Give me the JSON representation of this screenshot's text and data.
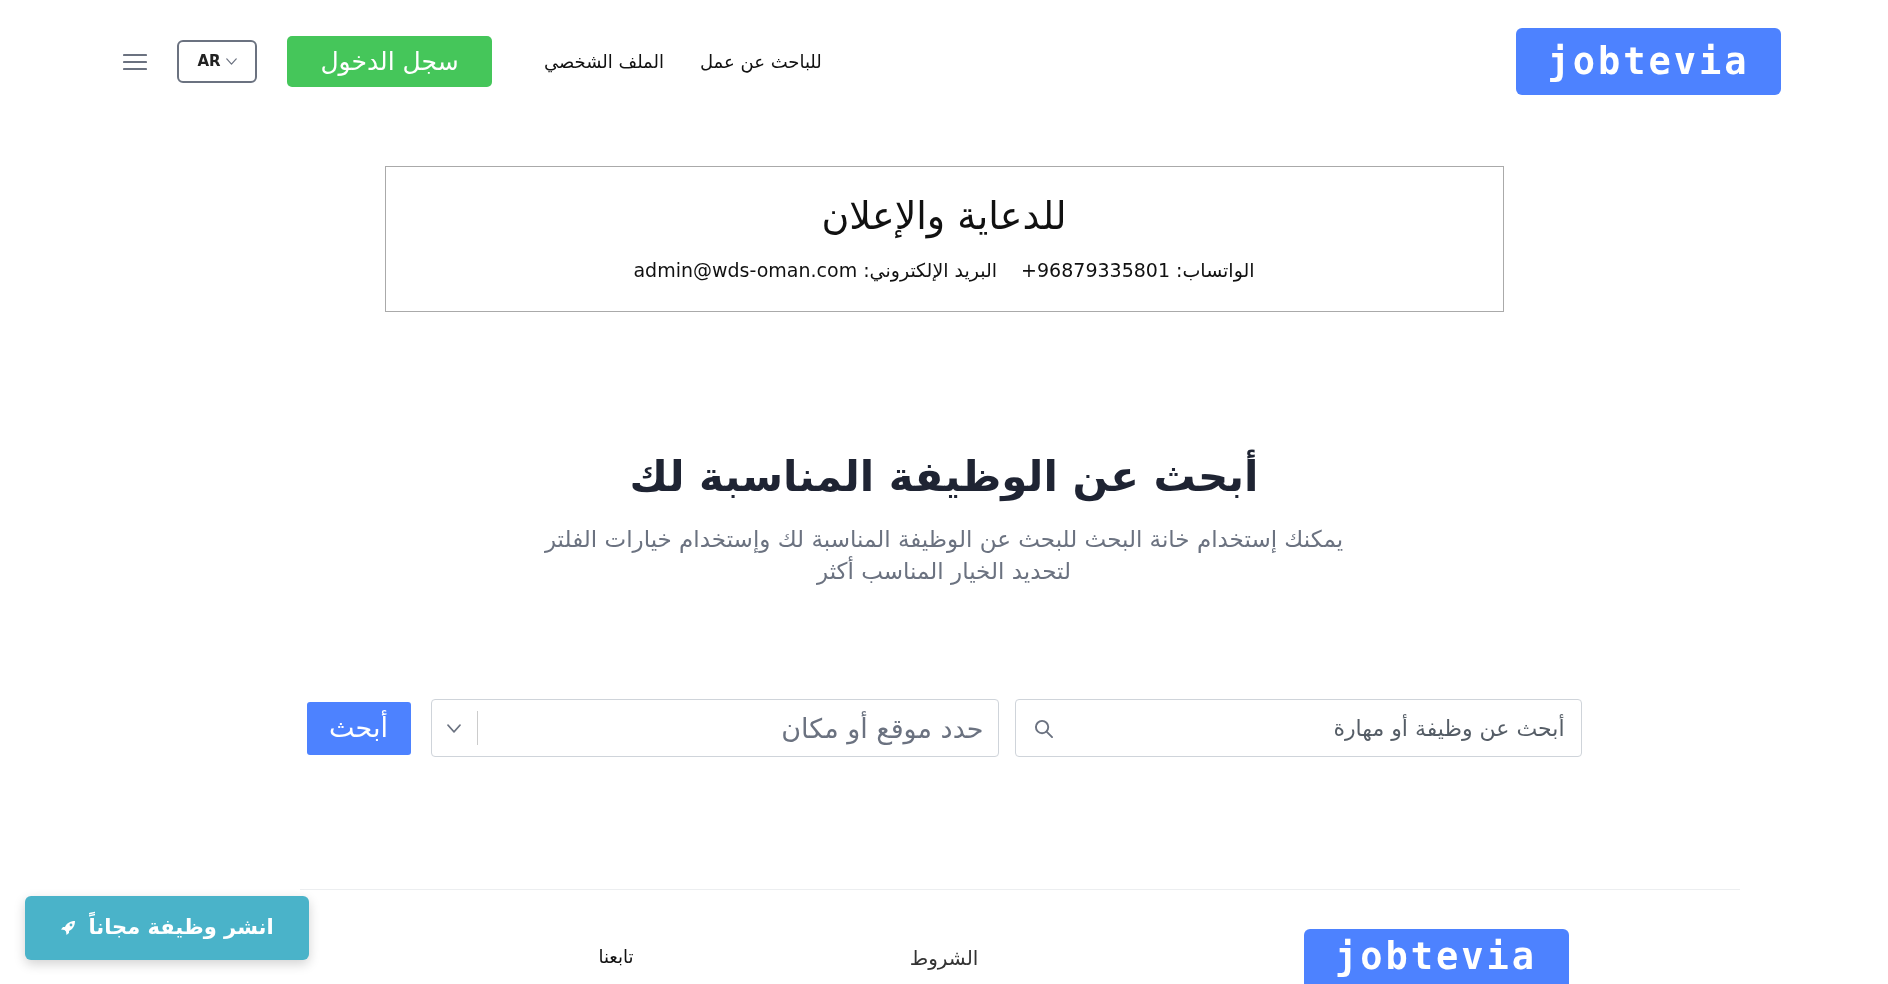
{
  "header": {
    "logo": "jobtevia",
    "nav_links": [
      "للباحث عن عمل",
      "الملف الشخصي"
    ],
    "login_button": "سجل الدخول",
    "language": "AR"
  },
  "ad_banner": {
    "title": "للدعاية والإعلان",
    "contacts": [
      {
        "label": "الواتساب:",
        "value": "+96879335801"
      },
      {
        "label": "البريد الإلكتروني:",
        "value": "admin@wds-oman.com"
      }
    ]
  },
  "hero": {
    "title": "أبحث عن الوظيفة المناسبة لك",
    "subtitle": "يمكنك إستخدام خانة البحث للبحث عن الوظيفة المناسبة لك وإستخدام خيارات الفلتر لتحديد الخيار المناسب أكثر"
  },
  "search": {
    "keyword": {
      "placeholder": "أبحث عن وظيفة أو مهارة"
    },
    "location": {
      "placeholder": "حدد موقع أو مكان"
    },
    "button": "أبحث"
  },
  "footer": {
    "logo": "jobtevia",
    "links": [
      "الشروط"
    ],
    "follow_heading": "تابعنا"
  },
  "post_job_button": "انشر وظيفة مجاناً"
}
